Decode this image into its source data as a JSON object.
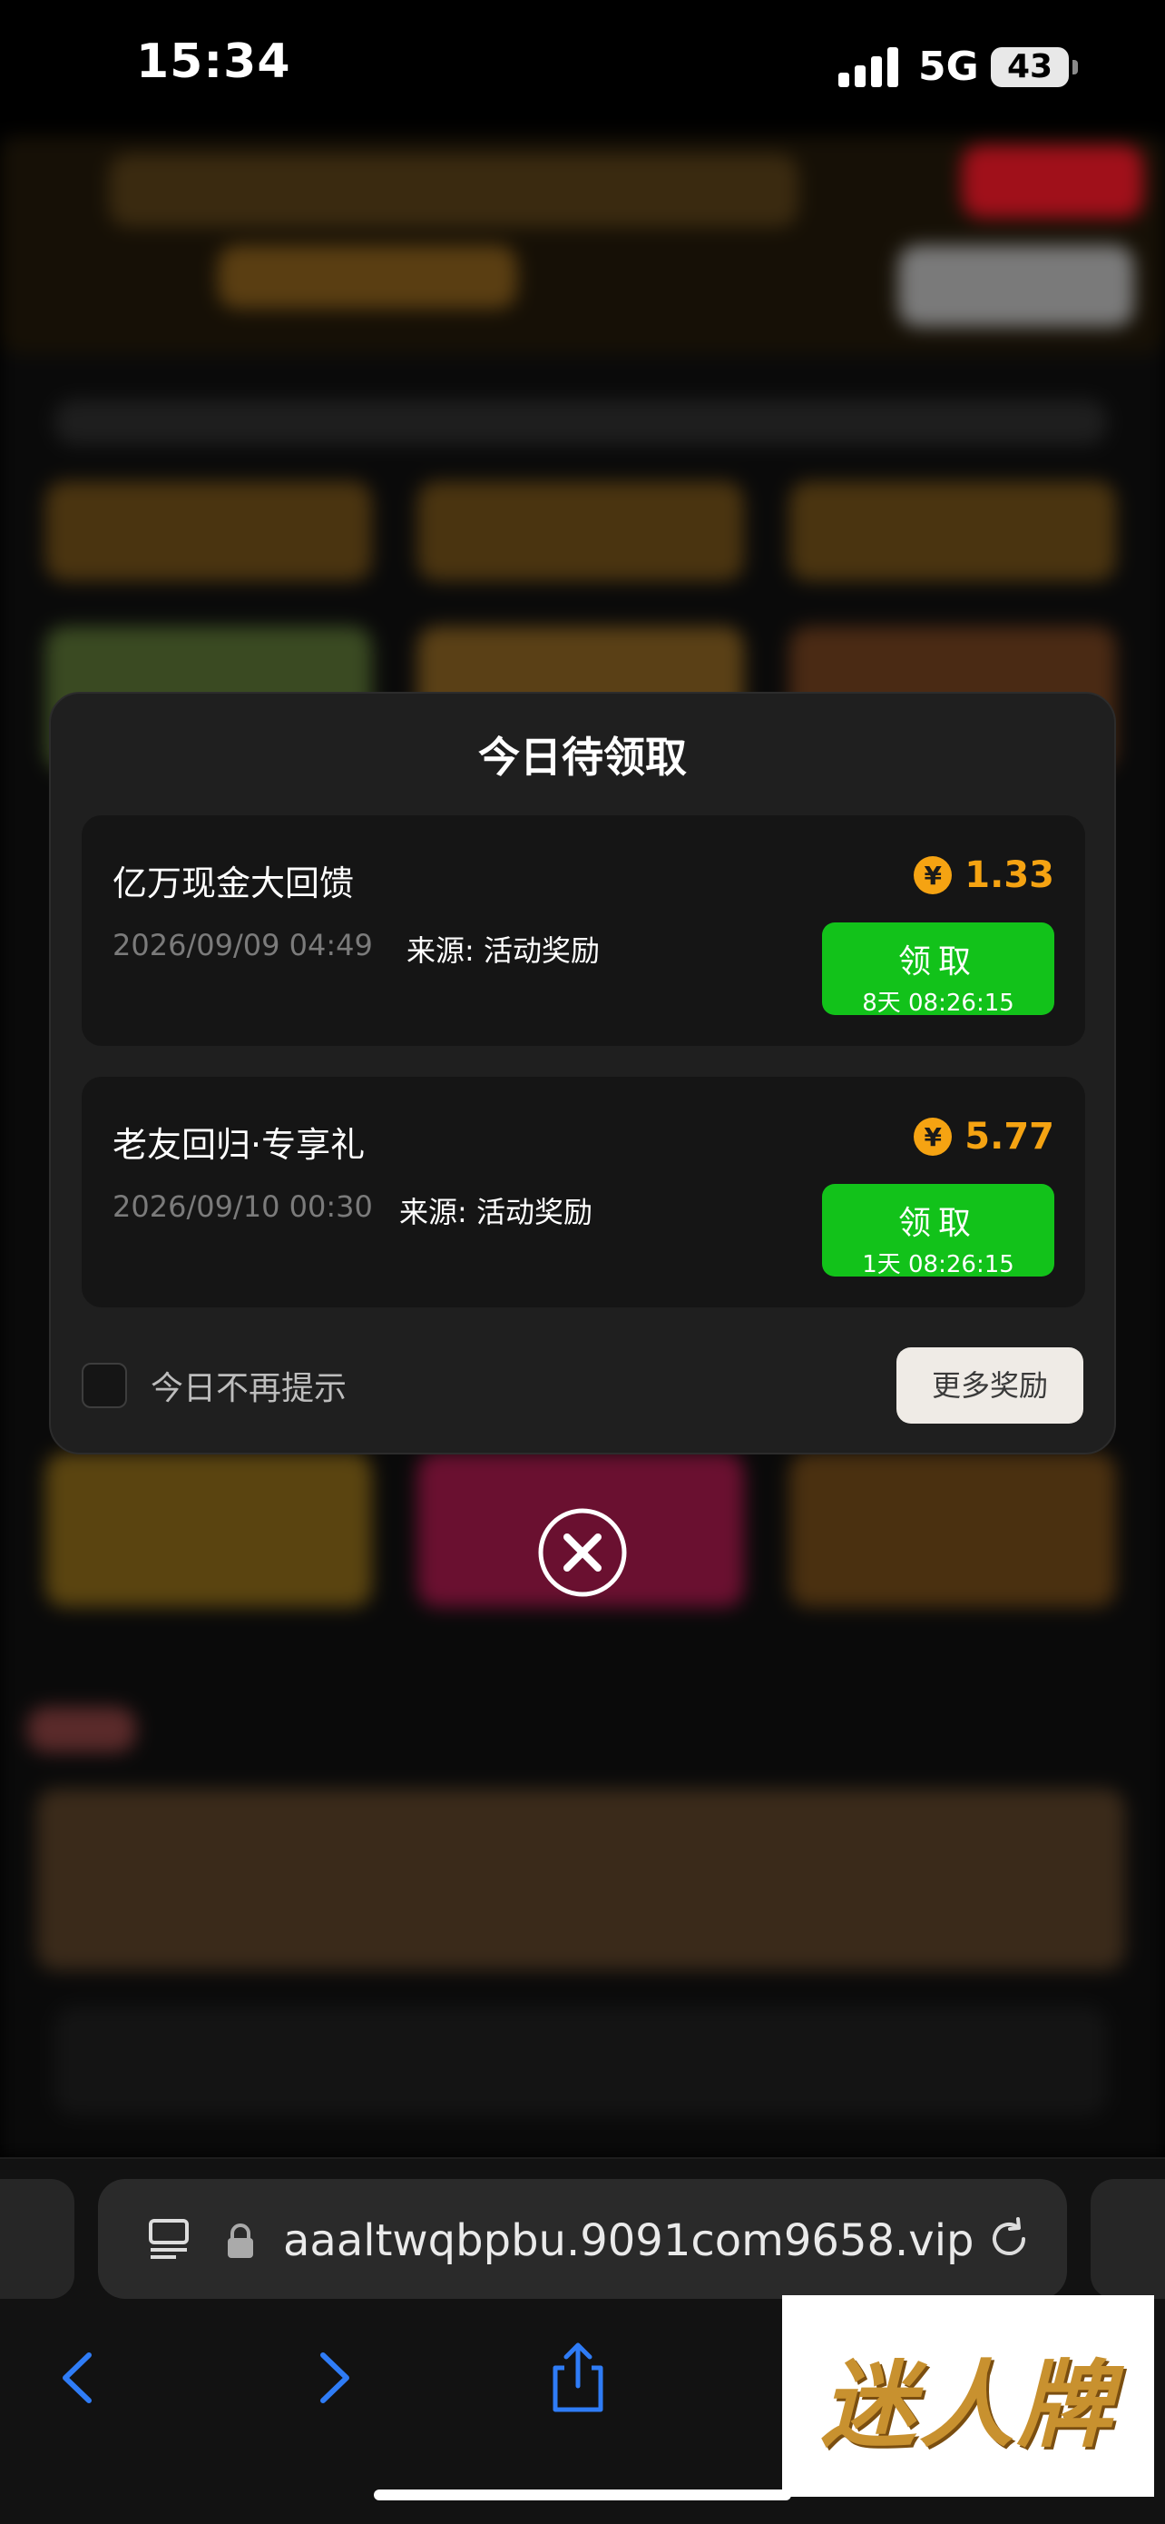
{
  "status_bar": {
    "time": "15:34",
    "network": "5G",
    "battery": "43"
  },
  "modal": {
    "title": "今日待领取",
    "rewards": [
      {
        "name": "亿万现金大回馈",
        "amount": "1.33",
        "date": "2026/09/09 04:49",
        "source": "来源: 活动奖励",
        "claim_label": "领取",
        "timer": "8天 08:26:15"
      },
      {
        "name": "老友回归·专享礼",
        "amount": "5.77",
        "date": "2026/09/10 00:30",
        "source": "来源: 活动奖励",
        "claim_label": "领取",
        "timer": "1天 08:26:15"
      }
    ],
    "no_remind_label": "今日不再提示",
    "more_rewards_label": "更多奖励",
    "coin_symbol": "¥"
  },
  "browser": {
    "url": "aaaltwqbpbu.9091com9658.vip"
  },
  "watermark": {
    "text": "迷人牌"
  },
  "colors": {
    "accent_green": "#12c21a",
    "coin_orange": "#f5a312",
    "modal_bg": "#1f1f1f"
  }
}
